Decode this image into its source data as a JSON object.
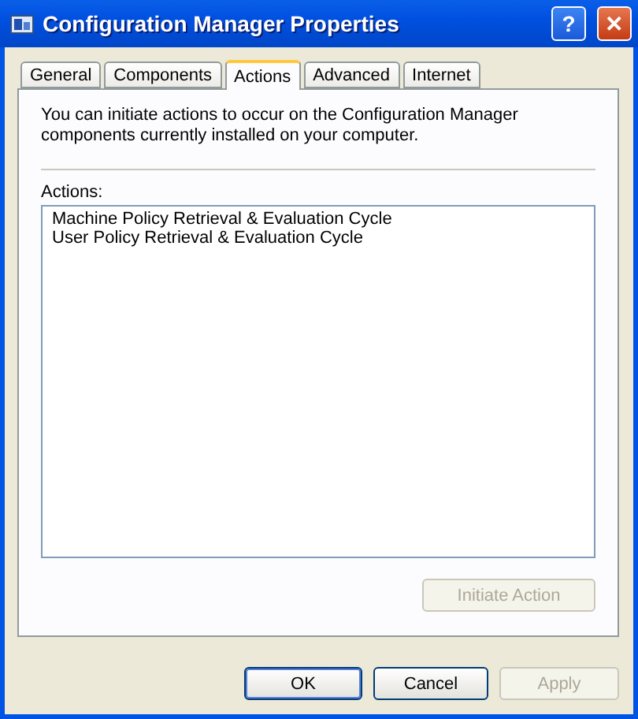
{
  "window": {
    "title": "Configuration Manager Properties",
    "controls": [
      {
        "kind": "help",
        "label": "?"
      },
      {
        "kind": "close",
        "label": "✕"
      }
    ]
  },
  "tabs": [
    {
      "label": "General",
      "selected": false
    },
    {
      "label": "Components",
      "selected": false
    },
    {
      "label": "Actions",
      "selected": true
    },
    {
      "label": "Advanced",
      "selected": false
    },
    {
      "label": "Internet",
      "selected": false
    }
  ],
  "description": "You can initiate actions to occur on the Configuration Manager components currently installed on your computer.",
  "actions": {
    "label": "Actions:",
    "items": [
      "Machine Policy Retrieval & Evaluation Cycle",
      "User Policy Retrieval & Evaluation Cycle"
    ],
    "button": {
      "label": "Initiate Action",
      "disabled": true
    }
  },
  "buttons": [
    {
      "label": "OK",
      "disabled": false,
      "default": true
    },
    {
      "label": "Cancel",
      "disabled": false,
      "default": false
    },
    {
      "label": "Apply",
      "disabled": true,
      "default": false
    }
  ]
}
